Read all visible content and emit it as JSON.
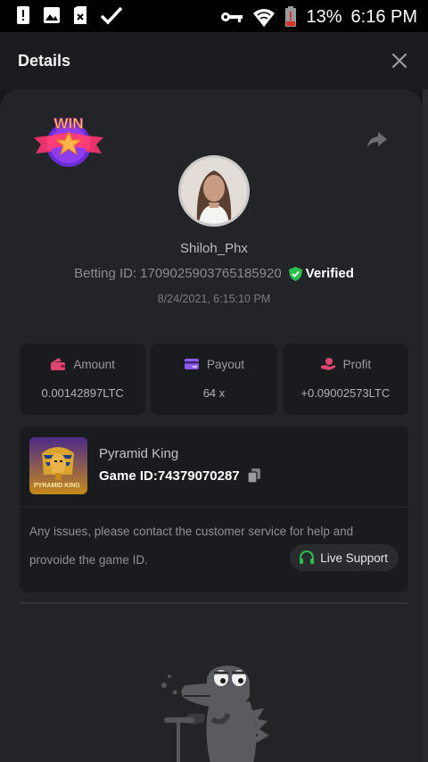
{
  "status_bar": {
    "battery_percent": "13%",
    "time": "6:16 PM",
    "icons": [
      "alert-icon",
      "image-icon",
      "sim-icon",
      "check-icon",
      "key-icon",
      "wifi-icon",
      "battery-icon"
    ]
  },
  "header": {
    "title": "Details",
    "close_icon": "close-icon"
  },
  "bet": {
    "badge_text": "WIN",
    "username": "Shiloh_Phx",
    "betting_id_label": "Betting ID:",
    "betting_id": "1709025903765185920",
    "verified_label": "Verified",
    "timestamp": "8/24/2021, 6:15:10 PM"
  },
  "stats": [
    {
      "label": "Amount",
      "value": "0.00142897LTC",
      "icon": "wallet-icon",
      "icon_color": "#e0456e"
    },
    {
      "label": "Payout",
      "value": "64 x",
      "icon": "card-icon",
      "icon_color": "#8f5cf2"
    },
    {
      "label": "Profit",
      "value": "+0.09002573LTC",
      "icon": "hand-coin-icon",
      "icon_color": "#e0456e"
    }
  ],
  "game": {
    "name": "Pyramid King",
    "id_label": "Game ID:",
    "id": "74379070287",
    "thumb_text": "PYRAMID KING",
    "notice": "Any issues, please contact the customer service for help and provoide the game ID.",
    "support_label": "Live Support"
  },
  "colors": {
    "accent_green": "#2bc04a",
    "panel": "#232428",
    "tile": "#1a1b1e"
  }
}
